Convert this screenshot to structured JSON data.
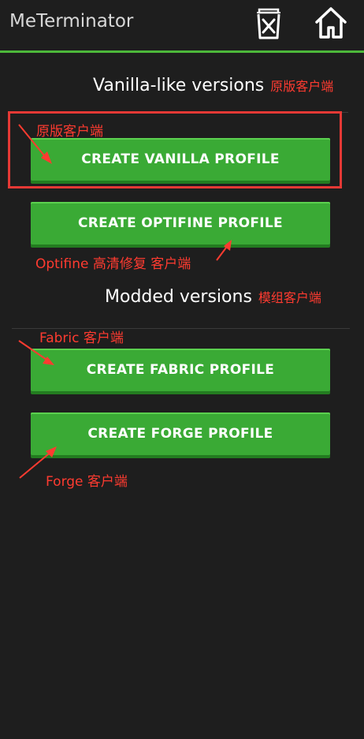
{
  "app": {
    "title": "MeTerminator"
  },
  "toolbar": {
    "delete_icon": "trash-x-icon",
    "home_icon": "home-icon",
    "accent_color": "#4db83a"
  },
  "sections": {
    "vanilla": {
      "title": "Vanilla-like versions",
      "note": "原版客户端"
    },
    "modded": {
      "title": "Modded versions",
      "note": "模组客户端"
    }
  },
  "buttons": {
    "vanilla": "CREATE VANILLA PROFILE",
    "optifine": "CREATE OPTIFINE PROFILE",
    "fabric": "CREATE FABRIC PROFILE",
    "forge": "CREATE FORGE PROFILE",
    "color": "#3aaa35"
  },
  "annotations": {
    "vanilla": "原版客户端",
    "optifine": "Optifine 高清修复 客户端",
    "fabric": "Fabric 客户端",
    "forge": "Forge 客户端",
    "color": "#ff3b30"
  }
}
